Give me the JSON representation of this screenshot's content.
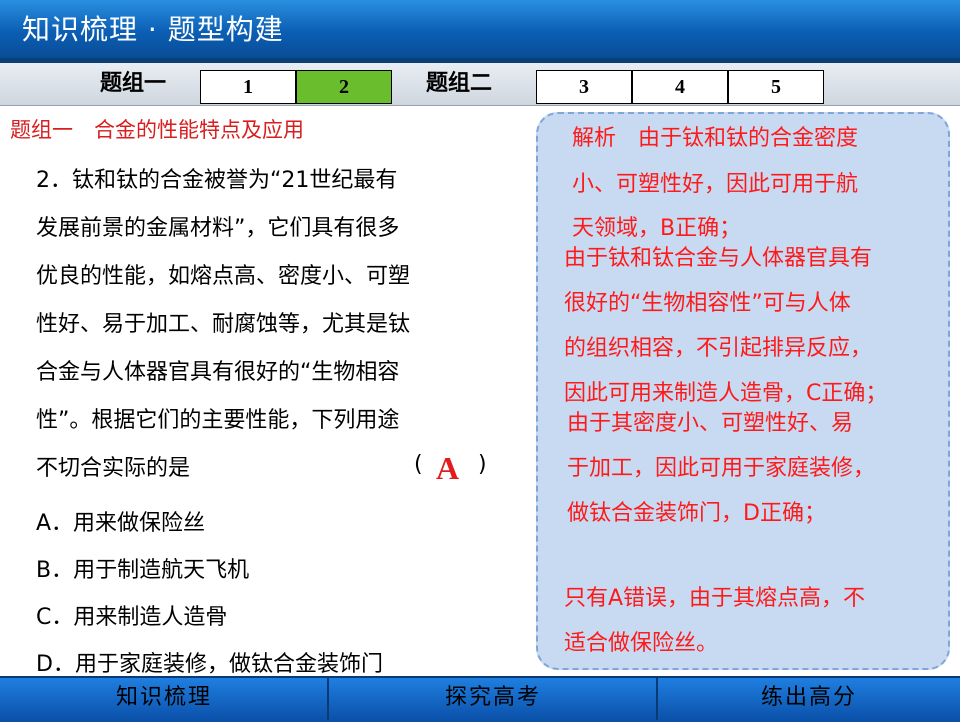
{
  "header": {
    "title": "知识梳理 · 题型构建"
  },
  "nav": {
    "group1_label": "题组一",
    "group2_label": "题组二",
    "tabs": [
      {
        "label": "1",
        "active": false
      },
      {
        "label": "2",
        "active": true
      },
      {
        "label": "3",
        "active": false
      },
      {
        "label": "4",
        "active": false
      },
      {
        "label": "5",
        "active": false
      }
    ]
  },
  "question": {
    "section_title": "题组一　合金的性能特点及应用",
    "lines": [
      "2．钛和钛的合金被誉为“21世纪最有",
      "发展前景的金属材料”，它们具有很多",
      "优良的性能，如熔点高、密度小、可塑",
      "性好、易于加工、耐腐蚀等，尤其是钛",
      "合金与人体器官具有很好的“生物相容",
      "性”。根据它们的主要性能，下列用途",
      "不切合实际的是"
    ],
    "paren_open": "(",
    "paren_close": ")",
    "answer": "A",
    "options": [
      "A．用来做保险丝",
      "B．用于制造航天飞机",
      "C．用来制造人造骨",
      "D．用于家庭装修，做钛合金装饰门"
    ]
  },
  "explanation": {
    "lines": [
      "解析　由于钛和钛的合金密度",
      "小、可塑性好，因此可用于航",
      "天领域，B正确；",
      "由于钛和钛合金与人体器官具有",
      "很好的“生物相容性”可与人体",
      "的组织相容，不引起排异反应，",
      "因此可用来制造人造骨，C正确；",
      "由于其密度小、可塑性好、易",
      "于加工，因此可用于家庭装修，",
      "做钛合金装饰门，D正确；",
      "只有A错误，由于其熔点高，不",
      "适合做保险丝。"
    ]
  },
  "bottom_nav": {
    "items": [
      "知识梳理",
      "探究高考",
      "练出高分"
    ]
  },
  "colors": {
    "header_blue": "#0b5fb5",
    "active_tab": "#6abd2d",
    "red_text": "#ff1a1a",
    "bubble_bg": "#c7daf2"
  }
}
